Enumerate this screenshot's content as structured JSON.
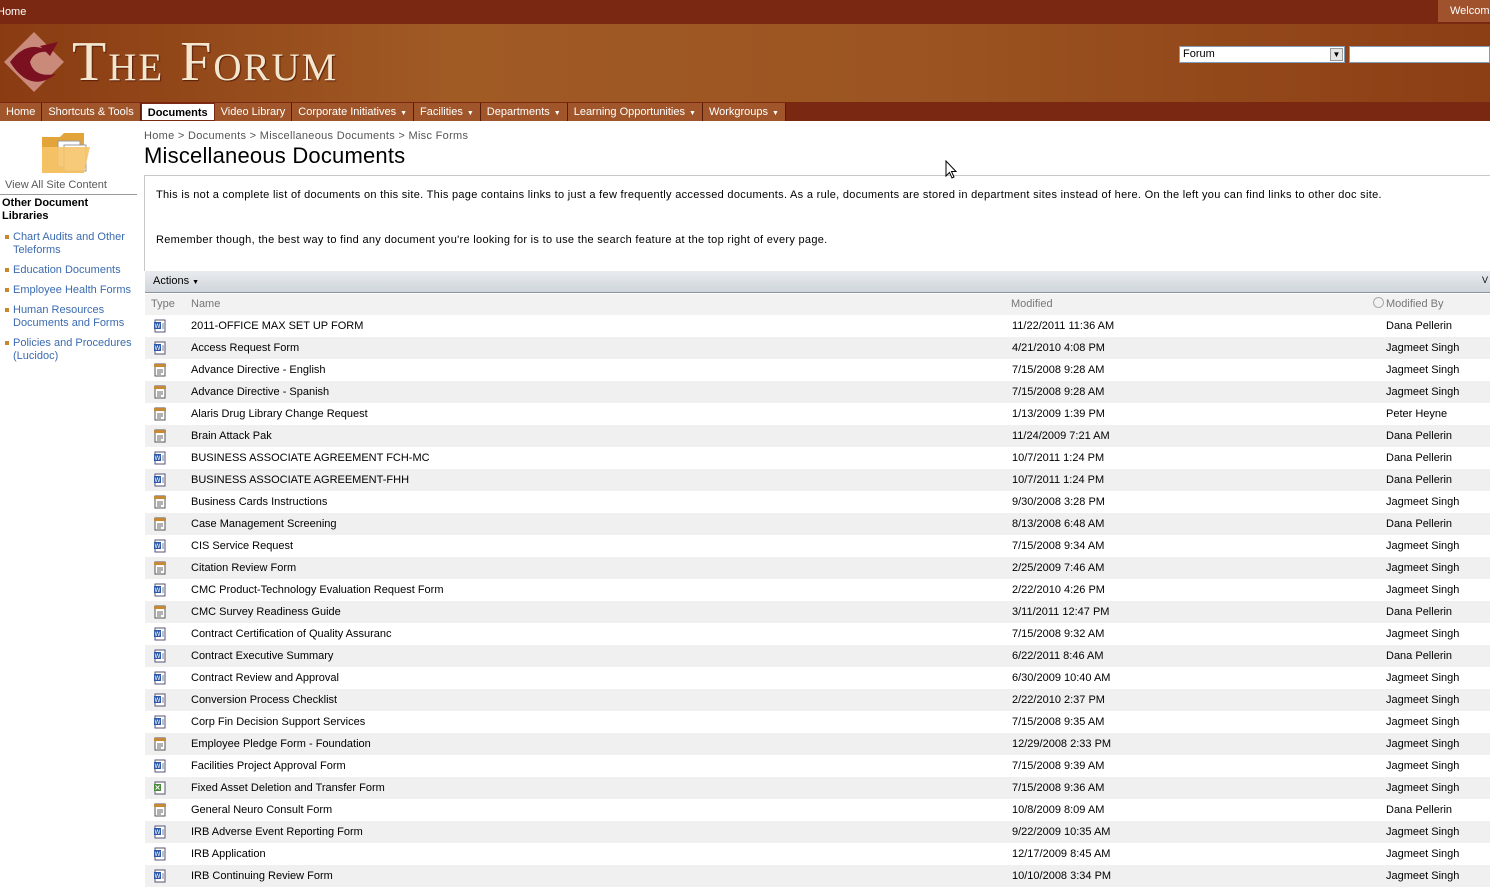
{
  "topbar": {
    "home": "Home",
    "welcome": "Welcome"
  },
  "banner": {
    "title": "The Forum"
  },
  "search": {
    "scope": "Forum",
    "value": ""
  },
  "nav": {
    "tabs": [
      {
        "label": "Home",
        "dropdown": false,
        "active": false
      },
      {
        "label": "Shortcuts & Tools",
        "dropdown": false,
        "active": false
      },
      {
        "label": "Documents",
        "dropdown": false,
        "active": true
      },
      {
        "label": "Video Library",
        "dropdown": false,
        "active": false
      },
      {
        "label": "Corporate Initiatives",
        "dropdown": true,
        "active": false
      },
      {
        "label": "Facilities",
        "dropdown": true,
        "active": false
      },
      {
        "label": "Departments",
        "dropdown": true,
        "active": false
      },
      {
        "label": "Learning Opportunities",
        "dropdown": true,
        "active": false
      },
      {
        "label": "Workgroups",
        "dropdown": true,
        "active": false
      }
    ]
  },
  "leftnav": {
    "view_all": "View All Site Content",
    "heading": "Other Document Libraries",
    "items": [
      "Chart Audits and Other Teleforms",
      "Education Documents",
      "Employee Health Forms",
      "Human Resources Documents and Forms",
      "Policies and Procedures (Lucidoc)"
    ]
  },
  "breadcrumb": "Home  >  Documents  >  Miscellaneous Documents  >  Misc Forms",
  "page_title": "Miscellaneous Documents",
  "note": {
    "line1": "This is not a complete list of documents on this site. This page contains links to just a few frequently accessed documents. As a rule, documents are stored in department sites instead of here. On the left you can find links to other doc site.",
    "line2": "Remember though, the best way to find any document you're looking for is to use the search feature at the top right of every page."
  },
  "toolbar": {
    "actions": "Actions",
    "right": "V"
  },
  "columns": {
    "type": "Type",
    "name": "Name",
    "modified": "Modified",
    "modified_by": "Modified By"
  },
  "documents": [
    {
      "type": "word",
      "name": "2011-OFFICE MAX SET UP FORM",
      "modified": "11/22/2011 11:36 AM",
      "by": "Dana Pellerin"
    },
    {
      "type": "word",
      "name": "Access Request Form",
      "modified": "4/21/2010 4:08 PM",
      "by": "Jagmeet Singh"
    },
    {
      "type": "pdf",
      "name": "Advance Directive - English",
      "modified": "7/15/2008 9:28 AM",
      "by": "Jagmeet Singh"
    },
    {
      "type": "pdf",
      "name": "Advance Directive - Spanish",
      "modified": "7/15/2008 9:28 AM",
      "by": "Jagmeet Singh"
    },
    {
      "type": "pdf",
      "name": "Alaris Drug Library Change Request",
      "modified": "1/13/2009 1:39 PM",
      "by": "Peter Heyne"
    },
    {
      "type": "pdf",
      "name": "Brain Attack Pak",
      "modified": "11/24/2009 7:21 AM",
      "by": "Dana Pellerin"
    },
    {
      "type": "word",
      "name": "BUSINESS ASSOCIATE AGREEMENT FCH-MC",
      "modified": "10/7/2011 1:24 PM",
      "by": "Dana Pellerin"
    },
    {
      "type": "word",
      "name": "BUSINESS ASSOCIATE AGREEMENT-FHH",
      "modified": "10/7/2011 1:24 PM",
      "by": "Dana Pellerin"
    },
    {
      "type": "pdf",
      "name": "Business Cards Instructions",
      "modified": "9/30/2008 3:28 PM",
      "by": "Jagmeet Singh"
    },
    {
      "type": "pdf",
      "name": "Case Management Screening",
      "modified": "8/13/2008 6:48 AM",
      "by": "Dana Pellerin"
    },
    {
      "type": "word",
      "name": "CIS Service Request",
      "modified": "7/15/2008 9:34 AM",
      "by": "Jagmeet Singh"
    },
    {
      "type": "pdf",
      "name": "Citation Review Form",
      "modified": "2/25/2009 7:46 AM",
      "by": "Jagmeet Singh"
    },
    {
      "type": "word",
      "name": "CMC Product-Technology Evaluation Request Form",
      "modified": "2/22/2010 4:26 PM",
      "by": "Jagmeet Singh"
    },
    {
      "type": "pdf",
      "name": "CMC Survey Readiness Guide",
      "modified": "3/11/2011 12:47 PM",
      "by": "Dana Pellerin"
    },
    {
      "type": "word",
      "name": "Contract Certification of Quality Assuranc",
      "modified": "7/15/2008 9:32 AM",
      "by": "Jagmeet Singh"
    },
    {
      "type": "word",
      "name": "Contract Executive Summary",
      "modified": "6/22/2011 8:46 AM",
      "by": "Dana Pellerin"
    },
    {
      "type": "word",
      "name": "Contract Review and Approval",
      "modified": "6/30/2009 10:40 AM",
      "by": "Jagmeet Singh"
    },
    {
      "type": "word",
      "name": "Conversion Process Checklist",
      "modified": "2/22/2010 2:37 PM",
      "by": "Jagmeet Singh"
    },
    {
      "type": "word",
      "name": "Corp Fin Decision Support Services",
      "modified": "7/15/2008 9:35 AM",
      "by": "Jagmeet Singh"
    },
    {
      "type": "pdf",
      "name": "Employee Pledge Form - Foundation",
      "modified": "12/29/2008 2:33 PM",
      "by": "Jagmeet Singh"
    },
    {
      "type": "word",
      "name": "Facilities Project Approval Form",
      "modified": "7/15/2008 9:39 AM",
      "by": "Jagmeet Singh"
    },
    {
      "type": "excel",
      "name": "Fixed Asset Deletion and Transfer Form",
      "modified": "7/15/2008 9:36 AM",
      "by": "Jagmeet Singh"
    },
    {
      "type": "pdf",
      "name": "General Neuro Consult Form",
      "modified": "10/8/2009 8:09 AM",
      "by": "Dana Pellerin"
    },
    {
      "type": "word",
      "name": "IRB Adverse Event Reporting Form",
      "modified": "9/22/2009 10:35 AM",
      "by": "Jagmeet Singh"
    },
    {
      "type": "word",
      "name": "IRB Application",
      "modified": "12/17/2009 8:45 AM",
      "by": "Jagmeet Singh"
    },
    {
      "type": "word",
      "name": "IRB Continuing Review Form",
      "modified": "10/10/2008 3:34 PM",
      "by": "Jagmeet Singh"
    }
  ],
  "icons": {
    "word": "word-doc-icon",
    "pdf": "pdf-doc-icon",
    "excel": "excel-doc-icon"
  },
  "colors": {
    "banner": "#8a3b12",
    "nav": "#7a2812",
    "link": "#3b6bb0"
  }
}
